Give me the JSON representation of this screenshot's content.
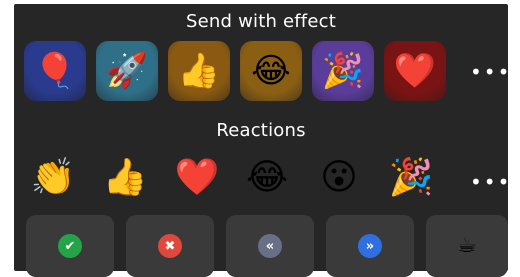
{
  "titles": {
    "effects": "Send with effect",
    "reactions": "Reactions"
  },
  "effects": [
    {
      "name": "balloon",
      "glyph": "🎈",
      "bg": "#2a3a8c"
    },
    {
      "name": "rocket",
      "glyph": "🚀",
      "bg": "#2f6f88"
    },
    {
      "name": "thumbs-up",
      "glyph": "👍",
      "bg": "#8a5a12"
    },
    {
      "name": "tears-of-joy",
      "glyph": "😂",
      "bg": "#8a5f14"
    },
    {
      "name": "party-popper",
      "glyph": "🎉",
      "bg": "#5a3d9a"
    },
    {
      "name": "heart",
      "glyph": "❤️",
      "bg": "#7a1414"
    }
  ],
  "reactions": [
    {
      "name": "clapping-hands",
      "glyph": "👏"
    },
    {
      "name": "thumbs-up",
      "glyph": "👍"
    },
    {
      "name": "heart",
      "glyph": "❤️"
    },
    {
      "name": "tears-of-joy",
      "glyph": "😂"
    },
    {
      "name": "surprised-face",
      "glyph": "😮"
    },
    {
      "name": "party-popper",
      "glyph": "🎉"
    }
  ],
  "more": "•••",
  "actions": [
    {
      "name": "check",
      "glyph": "✔",
      "color": "#22a447"
    },
    {
      "name": "close",
      "glyph": "✖",
      "color": "#e0483c"
    },
    {
      "name": "rewind",
      "glyph": "«",
      "color": "#6a6f88"
    },
    {
      "name": "fast-forward",
      "glyph": "»",
      "color": "#2f6fe0"
    },
    {
      "name": "coffee",
      "glyph": "☕",
      "color": ""
    }
  ]
}
